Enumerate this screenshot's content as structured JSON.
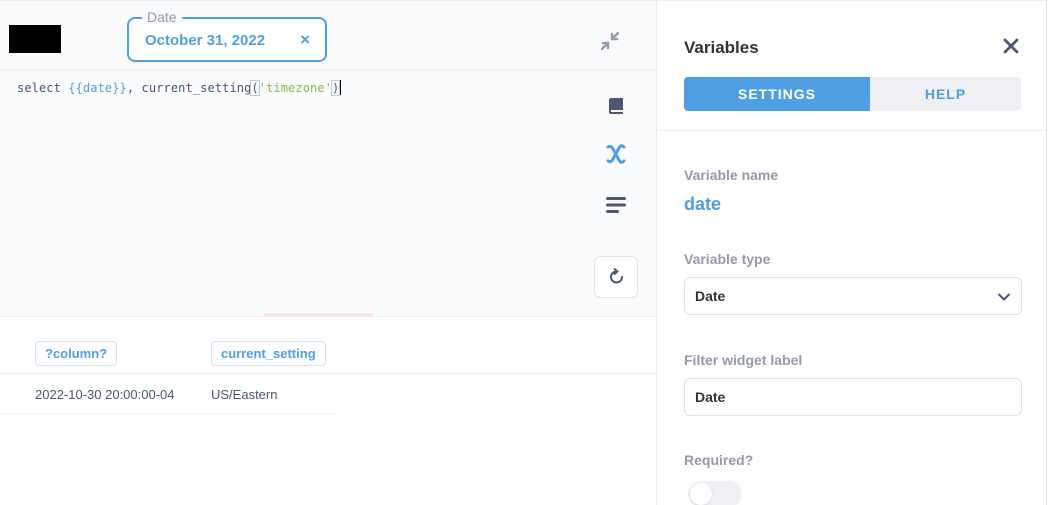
{
  "filter_widget": {
    "legend": "Date",
    "value": "October 31, 2022",
    "clear_glyph": "×"
  },
  "toolbar": {
    "collapse_icon": "collapse-icon"
  },
  "editor": {
    "code": {
      "kw_select": "select ",
      "var": "{{date}}",
      "comma": ", ",
      "fn": "current_setting",
      "open_paren": "(",
      "str": "'timezone'",
      "close_paren": ")"
    },
    "side_icons": [
      "book-icon",
      "variable-icon",
      "snippet-icon",
      "refresh-icon"
    ]
  },
  "results": {
    "columns": [
      "?column?",
      "current_setting"
    ],
    "rows": [
      [
        "2022-10-30 20:00:00-04",
        "US/Eastern"
      ]
    ]
  },
  "panel": {
    "title": "Variables",
    "close_glyph": "×",
    "tabs": [
      "SETTINGS",
      "HELP"
    ],
    "active_tab": "SETTINGS",
    "variable_name_label": "Variable name",
    "variable_name_value": "date",
    "variable_type_label": "Variable type",
    "variable_type_value": "Date",
    "filter_label_label": "Filter widget label",
    "filter_label_value": "Date",
    "required_label": "Required?",
    "required_value": false
  },
  "colors": {
    "brand": "#509ee3",
    "text_dark": "#2e353b",
    "text_medium": "#4c5773",
    "text_light": "#949aab",
    "string_green": "#84bb4c"
  }
}
